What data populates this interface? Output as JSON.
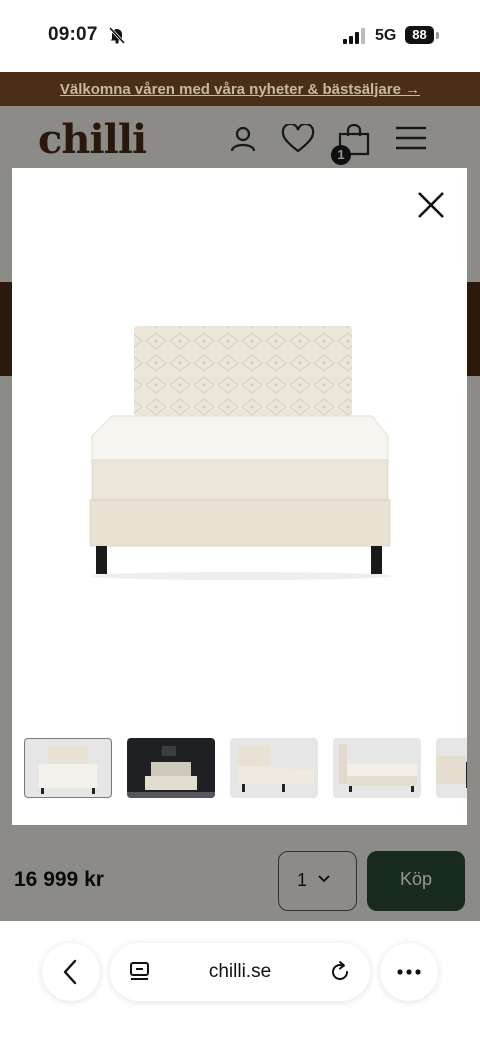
{
  "status_bar": {
    "time": "09:07",
    "network": "5G",
    "battery": "88"
  },
  "announcement": {
    "text": "Välkomna våren med våra nyheter & bästsäljare →"
  },
  "header": {
    "logo": "chilli",
    "cart_count": "1",
    "icons": [
      "user-icon",
      "heart-icon",
      "cart-icon",
      "menu-icon"
    ]
  },
  "gallery": {
    "main_image": "boxspring-bed-beige-tufted-headboard",
    "thumbnails": [
      "bed-front-white",
      "bed-dark-bedroom",
      "bed-side-angle",
      "bed-side-headboard",
      "bed-partial"
    ],
    "active_index": 0
  },
  "buy_bar": {
    "price": "16 999 kr",
    "quantity": "1",
    "buy_label": "Köp"
  },
  "browser": {
    "url": "chilli.se"
  },
  "colors": {
    "brand_brown": "#4b2e16",
    "buy_green": "#2a4a32",
    "beige_bed": "#ece6da"
  }
}
